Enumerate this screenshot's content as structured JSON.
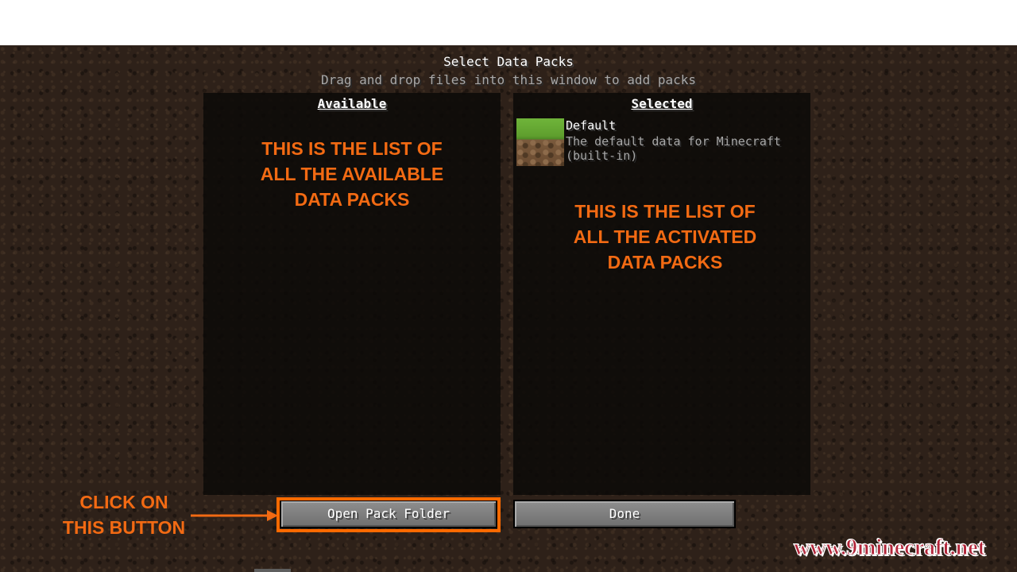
{
  "screen": {
    "title": "Select Data Packs",
    "subtitle": "Drag and drop files into this window to add packs"
  },
  "available_list": {
    "header": "Available",
    "items": []
  },
  "selected_list": {
    "header": "Selected",
    "items": [
      {
        "name": "Default",
        "description_line1": "The default data for Minecraft",
        "description_line2": "(built-in)",
        "icon": "grass-block-icon"
      }
    ]
  },
  "buttons": {
    "open_pack_folder": "Open Pack Folder",
    "done": "Done"
  },
  "annotations": {
    "available": [
      "THIS IS THE LIST OF",
      "ALL THE AVAILABLE",
      "DATA PACKS"
    ],
    "selected": [
      "THIS IS THE LIST OF",
      "ALL THE ACTIVATED",
      "DATA PACKS"
    ],
    "click": [
      "CLICK ON",
      "THIS BUTTON"
    ],
    "color": "#f26a13"
  },
  "watermark": "www.9minecraft.net"
}
